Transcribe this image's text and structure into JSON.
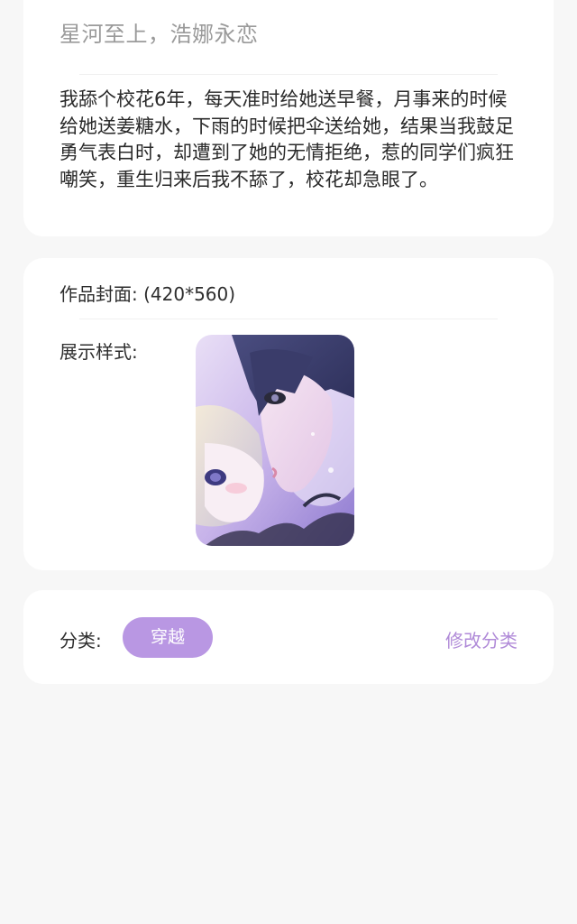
{
  "info": {
    "title": "星河至上，浩娜永恋",
    "synopsis": "我舔个校花6年，每天准时给她送早餐，月事来的时候给她送姜糖水，下雨的时候把伞送给她，结果当我鼓足勇气表白时，却遭到了她的无情拒绝，惹的同学们疯狂嘲笑，重生归来后我不舔了，校花却急眼了。"
  },
  "cover": {
    "label": "作品封面: (420*560)",
    "style_label": "展示样式:",
    "image_icon": "anime-cover-illustration"
  },
  "category": {
    "label": "分类:",
    "tag": "穿越",
    "edit_label": "修改分类",
    "tag_color": "#b997e3",
    "edit_color": "#b08ad8"
  }
}
